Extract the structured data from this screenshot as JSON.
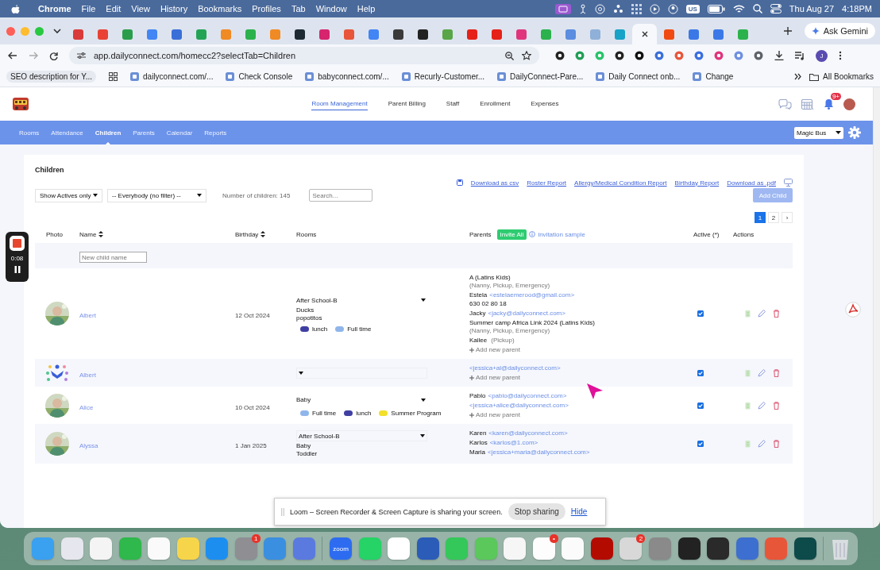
{
  "menu_bar": {
    "app": "Chrome",
    "menus": [
      "File",
      "Edit",
      "View",
      "History",
      "Bookmarks",
      "Profiles",
      "Tab",
      "Window",
      "Help"
    ],
    "input_source": "US",
    "date": "Thu Aug 27",
    "time": "4:18PM"
  },
  "browser": {
    "tabs": [
      {
        "selected": false
      },
      {
        "selected": false
      },
      {
        "selected": false
      },
      {
        "selected": false
      },
      {
        "selected": false
      },
      {
        "selected": false
      },
      {
        "selected": false
      },
      {
        "selected": false
      },
      {
        "selected": false
      },
      {
        "selected": false
      },
      {
        "selected": false
      },
      {
        "selected": false
      },
      {
        "selected": false
      },
      {
        "selected": false
      },
      {
        "selected": false
      },
      {
        "selected": false
      },
      {
        "selected": false
      },
      {
        "selected": false
      },
      {
        "selected": false
      },
      {
        "selected": false
      },
      {
        "selected": false
      },
      {
        "selected": false
      },
      {
        "selected": false
      },
      {
        "selected": true
      },
      {
        "selected": false
      },
      {
        "selected": false
      },
      {
        "selected": false
      },
      {
        "selected": false
      }
    ],
    "ask_button": "Ask Gemini",
    "url": "app.dailyconnect.com/homecc2?selectTab=Children",
    "profile_initial": "J",
    "bookmarks": [
      {
        "label": "SEO description for Y...",
        "icon": false
      },
      {
        "label": "dailyconnect.com/...",
        "icon": true
      },
      {
        "label": "Check Console",
        "icon": true
      },
      {
        "label": "babyconnect.com/...",
        "icon": true
      },
      {
        "label": "Recurly-Customer...",
        "icon": true
      },
      {
        "label": "DailyConnect-Pare...",
        "icon": true
      },
      {
        "label": "Daily Connect onb...",
        "icon": true
      },
      {
        "label": "Change",
        "icon": true
      }
    ],
    "all_bookmarks": "All Bookmarks"
  },
  "app": {
    "nav": [
      {
        "label": "Room Management",
        "selected": true
      },
      {
        "label": "Parent Billing",
        "selected": false
      },
      {
        "label": "Staff",
        "selected": false
      },
      {
        "label": "Enrollment",
        "selected": false
      },
      {
        "label": "Expenses",
        "selected": false
      }
    ],
    "notification_count": "9+",
    "subnav": [
      {
        "label": "Rooms",
        "selected": false
      },
      {
        "label": "Attendance",
        "selected": false
      },
      {
        "label": "Children",
        "selected": true
      },
      {
        "label": "Parents",
        "selected": false
      },
      {
        "label": "Calendar",
        "selected": false
      },
      {
        "label": "Reports",
        "selected": false
      }
    ],
    "school": "Magic Bus",
    "page_title": "Children",
    "links": [
      "Download as csv",
      "Roster Report",
      "Allergy/Medical Condition Report",
      "Birthday Report",
      "Download as .pdf"
    ],
    "status_filter": "Show Actives only",
    "group_filter": "-- Everybody (no filter) --",
    "count": "Number of children: 145",
    "search": {
      "placeholder": "Search..."
    },
    "add_button": "Add Child",
    "pages": [
      {
        "label": "1",
        "selected": true
      },
      {
        "label": "2",
        "selected": false
      },
      {
        "label": "›",
        "selected": false
      }
    ],
    "columns": [
      {
        "label": "Photo",
        "sortable": false
      },
      {
        "label": "Name",
        "sortable": true
      },
      {
        "label": "Birthday",
        "sortable": true
      },
      {
        "label": "Rooms",
        "sortable": false
      },
      {
        "label": "Parents",
        "sortable": false
      },
      {
        "label": "Active (*)",
        "sortable": false
      },
      {
        "label": "Actions",
        "sortable": false
      }
    ],
    "invite_button": "Invite All",
    "invitation_link": "invitation sample",
    "new_child": {
      "placeholder": "New child name"
    },
    "rows": [
      {
        "avatar": {
          "kind": "picture"
        },
        "name": "Albert",
        "birthday": "12 Oct 2024",
        "room": "After School-B",
        "extra_rooms": [
          "Ducks",
          "popotitos"
        ],
        "programs": [
          {
            "name": "lunch",
            "color": "#3f3fa3"
          },
          {
            "name": "Full time",
            "color": "#8fb6ea"
          }
        ],
        "parents": [
          {
            "name": "A (Latins Kids)",
            "roles": "(Nanny, Pickup, Emergency)"
          },
          {
            "name": "Estela",
            "email": "<estelaemerood@gmail.com>",
            "phone": "630 02 80 18"
          },
          {
            "name": "Jacky",
            "email": "<jacky@dailyconnect.com>"
          },
          {
            "name": "Summer camp Africa Link 2024 (Latins Kids)",
            "roles": "(Nanny, Pickup, Emergency)"
          },
          {
            "name": "Kailee",
            "inline_roles": "(Pickup)"
          }
        ],
        "add_parent": "Add new parent",
        "active": true
      },
      {
        "avatar": {
          "kind": "logo"
        },
        "name": "Albert",
        "extra_rooms": [],
        "programs": [],
        "parents": [
          {
            "email": "<jessica+al@dailyconnect.com>"
          }
        ],
        "add_parent": "Add new parent",
        "active": true
      },
      {
        "avatar": {
          "kind": "picture"
        },
        "name": "Alice",
        "birthday": "10 Oct 2024",
        "room": "Baby",
        "extra_rooms": [],
        "programs": [
          {
            "name": "Full time",
            "color": "#8fb6ea"
          },
          {
            "name": "lunch",
            "color": "#3f3fa3"
          },
          {
            "name": "Summer Program",
            "color": "#f2e02a"
          }
        ],
        "parents": [
          {
            "name": "Pablo",
            "email": "<pablo@dailyconnect.com>"
          },
          {
            "email": "<jessica+alice@dailyconnect.com>"
          }
        ],
        "add_parent": "Add new parent",
        "active": true
      },
      {
        "avatar": {
          "kind": "picture"
        },
        "name": "Alyssa",
        "birthday": "1 Jan 2025",
        "room": "After School-B",
        "extra_rooms": [
          "Baby",
          "Toddler"
        ],
        "programs": [],
        "parents": [
          {
            "name": "Karen",
            "email": "<karen@dailyconnect.com>"
          },
          {
            "name": "Karlos",
            "email": "<karlos@1.com>"
          },
          {
            "name": "Maria",
            "email": "<jessica+maria@dailyconnect.com>"
          }
        ],
        "active": true
      }
    ]
  },
  "loom": {
    "timer": "0:08",
    "message": "Loom – Screen Recorder & Screen Capture is sharing your screen.",
    "stop": "Stop sharing",
    "hide": "Hide"
  },
  "dock": {
    "items": [
      {
        "kind": "app"
      },
      {
        "kind": "app"
      },
      {
        "kind": "app"
      },
      {
        "kind": "app"
      },
      {
        "kind": "app"
      },
      {
        "kind": "app"
      },
      {
        "kind": "app"
      },
      {
        "kind": "app",
        "badge": "1"
      },
      {
        "kind": "app"
      },
      {
        "kind": "app"
      },
      {
        "kind": "separator"
      },
      {
        "kind": "app",
        "text": "zoom"
      },
      {
        "kind": "app"
      },
      {
        "kind": "app"
      },
      {
        "kind": "app"
      },
      {
        "kind": "app"
      },
      {
        "kind": "app"
      },
      {
        "kind": "app"
      },
      {
        "kind": "app",
        "badge": "•"
      },
      {
        "kind": "app"
      },
      {
        "kind": "app"
      },
      {
        "kind": "app",
        "badge": "2"
      },
      {
        "kind": "app"
      },
      {
        "kind": "app"
      },
      {
        "kind": "app"
      },
      {
        "kind": "app"
      },
      {
        "kind": "app"
      },
      {
        "kind": "app"
      },
      {
        "kind": "separator"
      },
      {
        "kind": "trash"
      }
    ]
  }
}
